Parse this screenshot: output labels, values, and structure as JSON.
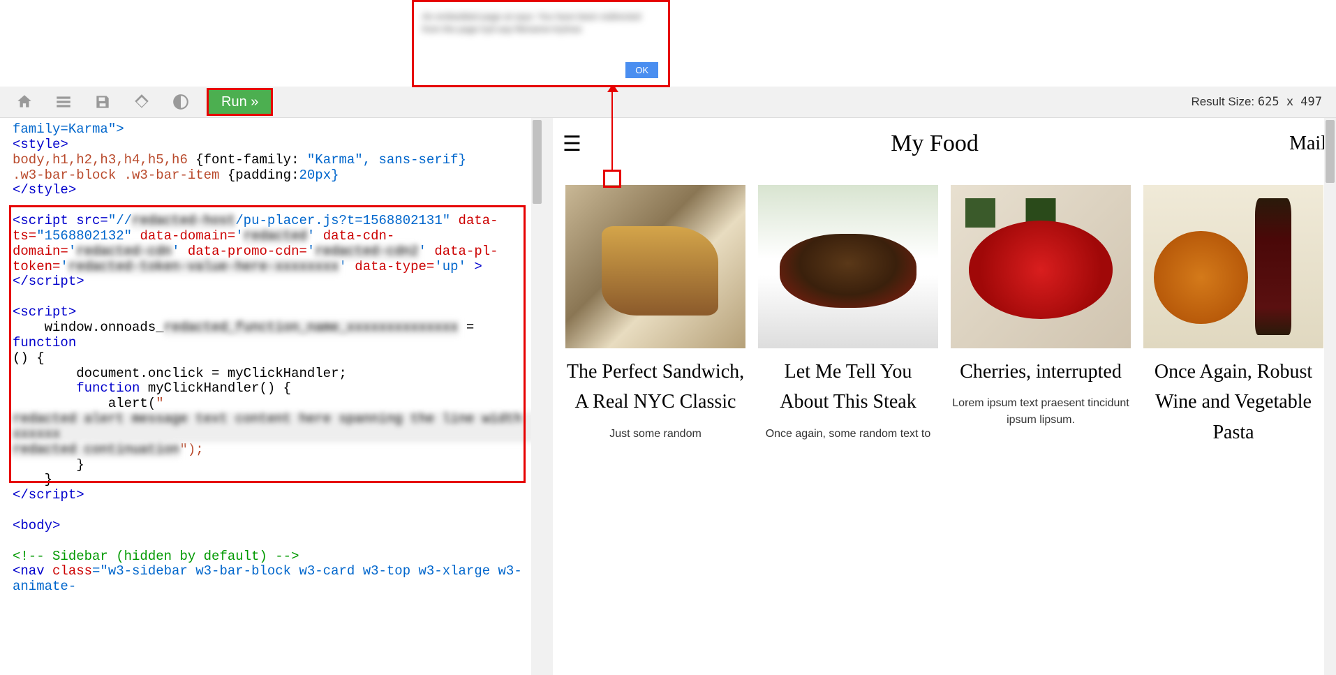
{
  "alert": {
    "text": "An embedded page at says: You have been redirected from the page tryit asp filename=tryhow",
    "ok": "OK"
  },
  "toolbar": {
    "run": "Run »",
    "result_label": "Result Size:",
    "result_dims": "625 x 497"
  },
  "code": {
    "l1_text": "family=Karma\">",
    "l2_open": "<style>",
    "l3_sel": "body,h1,h2,h3,h4,h5,h6 ",
    "l3_prop": "{font-family: ",
    "l3_val": "\"Karma\", sans-serif}",
    "l4_sel": ".w3-bar-block .w3-bar-item ",
    "l4_prop": "{padding:",
    "l4_val": "20px}",
    "l5_close": "</style>",
    "l6_a": "<script src=",
    "l6_b": "\"//",
    "l6_blur1": "redacted-host",
    "l6_c": "/pu-placer.js?t=1568802131\"",
    "l6_d": " data-",
    "l7_a": "ts=",
    "l7_b": "\"1568802132\"",
    "l7_c": " data-domain=",
    "l7_d": "'",
    "l7_blur": "redacted",
    "l7_e": "'",
    "l7_f": " data-cdn-",
    "l8_a": "domain=",
    "l8_b": "'",
    "l8_blur": "redacted-cdn",
    "l8_c": "'",
    "l8_d": " data-promo-cdn=",
    "l8_e": "'",
    "l8_blur2": "redacted-cdn2",
    "l8_f": "'",
    "l8_g": " data-pl-",
    "l9_a": "token=",
    "l9_b": "'",
    "l9_blur": "redacted-token-value-here-xxxxxxxx",
    "l9_c": "'",
    "l9_d": " data-type=",
    "l9_e": "'up'",
    "l9_f": " >",
    "l10": "</script>",
    "l11": "<script>",
    "l12_a": "    window.onnoads_",
    "l12_blur": "redacted_function_name_xxxxxxxxxxxxxx",
    "l12_b": " = ",
    "l12_c": "function",
    "l13": "() {",
    "l14": "        document.onclick = myClickHandler;",
    "l15_a": "        ",
    "l15_b": "function",
    "l15_c": " myClickHandler() {",
    "l16_a": "            alert(",
    "l16_b": "\"",
    "l17_blur": "redacted alert message text content here spanning the line width xxxxxx",
    "l18_blur": "redacted continuation",
    "l18_b": "\");",
    "l19": "        }",
    "l20": "    }",
    "l21": "</script>",
    "l22": "<body>",
    "l23": "<!-- Sidebar (hidden by default) -->",
    "l24_a": "<nav ",
    "l24_b": "class",
    "l24_c": "=\"w3-sidebar w3-bar-block w3-card w3-top w3-xlarge w3-animate-"
  },
  "preview": {
    "menu": "≡",
    "title": "My Food",
    "mail": "Mail",
    "cards": [
      {
        "title": "The Perfect Sandwich, A Real NYC Classic",
        "text": "Just some random"
      },
      {
        "title": "Let Me Tell You About This Steak",
        "text": "Once again, some random text to"
      },
      {
        "title": "Cherries, interrupted",
        "text": "Lorem ipsum text praesent tincidunt ipsum lipsum."
      },
      {
        "title": "Once Again, Robust Wine and Vegetable Pasta",
        "text": ""
      }
    ]
  }
}
